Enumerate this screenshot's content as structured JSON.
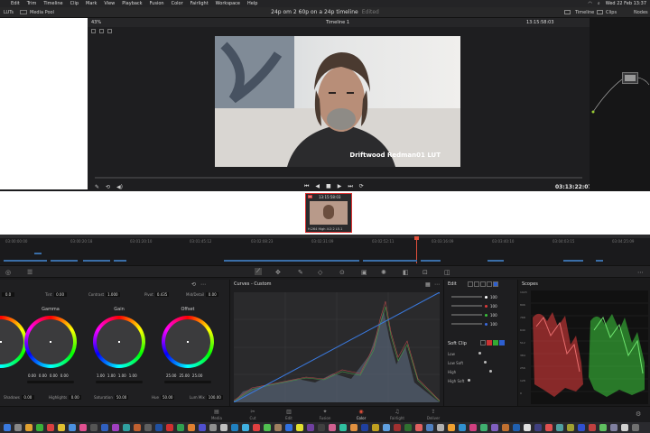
{
  "menubar": {
    "items": [
      "Edit",
      "Trim",
      "Timeline",
      "Clip",
      "Mark",
      "View",
      "Playback",
      "Fusion",
      "Color",
      "Fairlight",
      "Workspace",
      "Help"
    ],
    "date_time": "Wed 22 Feb 13:37"
  },
  "toolbar": {
    "luts_label": "LUTs",
    "media_pool_label": "Media Pool",
    "project_title": "24p om 2 60p on a 24p timeline",
    "edited_label": "Edited",
    "timeline_label": "Timeline",
    "clips_label": "Clips",
    "nodes_label": "Nodes"
  },
  "viewer": {
    "zoom": "43%",
    "timeline_name": "Timeline 1",
    "source_timecode": "13:15:58:03",
    "lut_caption": "Driftwood Redman01 LUT",
    "record_timecode": "03:13:22:07"
  },
  "clip_thumb": {
    "number": "01",
    "timecode": "13:15:58:03",
    "codec": "H.264 High 4:2:2 L5.1"
  },
  "timeline": {
    "timecodes": [
      "03:00:00:00",
      "03:00:20:18",
      "03:01:20:10",
      "03:01:45:12",
      "03:02:08:23",
      "03:02:31:09",
      "03:02:52:11",
      "03:03:16:09",
      "03:03:40:10",
      "03:04:03:15",
      "03:04:25:09"
    ]
  },
  "primaries": {
    "contrast_value": "0.0",
    "tint_label": "Tint",
    "tint_value": "0.00",
    "contrast_label": "Contrast",
    "contrast_amount": "1.000",
    "pivot_label": "Pivot",
    "pivot_value": "0.435",
    "middetail_label": "Mid/Detail",
    "middetail_value": "0.00",
    "gamma_label": "Gamma",
    "gamma_values": [
      "0.00",
      "0.00",
      "0.00",
      "0.00"
    ],
    "gain_label": "Gain",
    "gain_values": [
      "1.00",
      "1.00",
      "1.00",
      "1.00"
    ],
    "offset_label": "Offset",
    "offset_values": [
      "25.00",
      "25.00",
      "25.00"
    ],
    "shadows_label": "Shadows",
    "shadows_value": "0.00",
    "highlights_label": "Highlights",
    "highlights_value": "0.00",
    "saturation_label": "Saturation",
    "saturation_value": "50.00",
    "hue_label": "Hue",
    "hue_value": "50.00",
    "lummix_label": "Lum Mix",
    "lummix_value": "100.00"
  },
  "curves": {
    "title": "Curves - Custom"
  },
  "edit_panel": {
    "title": "Edit",
    "rows": [
      {
        "color": "#ffffff",
        "value": "100"
      },
      {
        "color": "#e03a3a",
        "value": "100"
      },
      {
        "color": "#3ac23a",
        "value": "100"
      },
      {
        "color": "#3a6ae0",
        "value": "100"
      }
    ],
    "softclip_label": "Soft Clip",
    "low_label": "Low",
    "low_soft_label": "Low Soft",
    "high_label": "High",
    "high_soft_label": "High Soft"
  },
  "scopes": {
    "title": "Scopes",
    "scale": [
      "1023",
      "896",
      "768",
      "640",
      "512",
      "384",
      "256",
      "128",
      "0"
    ]
  },
  "pages": [
    {
      "label": "Media",
      "icon": "media-icon"
    },
    {
      "label": "Cut",
      "icon": "cut-icon"
    },
    {
      "label": "Edit",
      "icon": "edit-icon"
    },
    {
      "label": "Fusion",
      "icon": "fusion-icon"
    },
    {
      "label": "Color",
      "icon": "color-icon",
      "active": true
    },
    {
      "label": "Fairlight",
      "icon": "fairlight-icon"
    },
    {
      "label": "Deliver",
      "icon": "deliver-icon"
    }
  ],
  "accent_color": "#e14f3a"
}
